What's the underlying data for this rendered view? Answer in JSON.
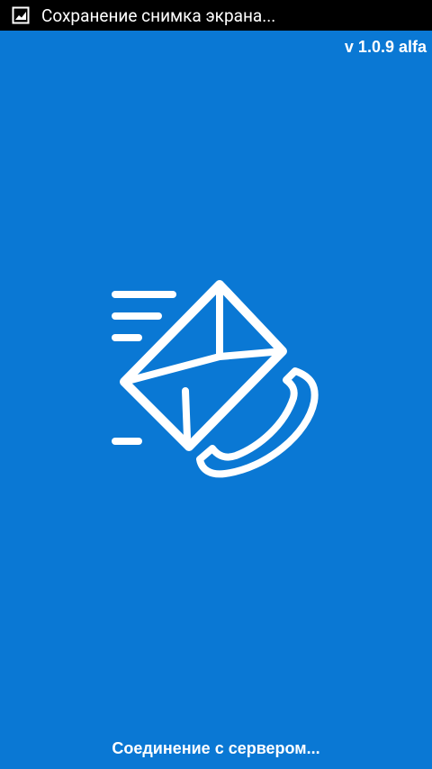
{
  "status_bar": {
    "notification_icon": "screenshot-gallery-icon",
    "text": "Сохранение снимка экрана..."
  },
  "app": {
    "version": "v 1.0.9 alfa",
    "logo_icon": "mail-phone-icon",
    "status_message": "Соединение с сервером..."
  },
  "colors": {
    "background": "#0a78d4",
    "status_bar": "#000000",
    "foreground": "#ffffff"
  }
}
